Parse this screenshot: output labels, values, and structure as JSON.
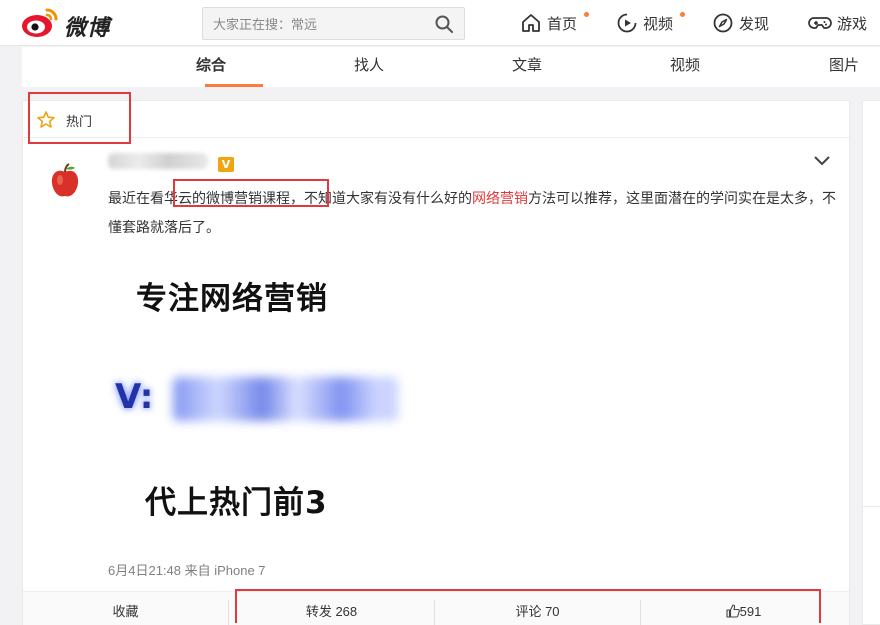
{
  "header": {
    "brand": "微博",
    "search_placeholder": "大家正在搜：常远",
    "nav": [
      {
        "label": "首页",
        "icon": "home-icon"
      },
      {
        "label": "视频",
        "icon": "video-icon"
      },
      {
        "label": "发现",
        "icon": "compass-icon"
      },
      {
        "label": "游戏",
        "icon": "gamepad-icon"
      }
    ]
  },
  "tabs": [
    "综合",
    "找人",
    "文章",
    "视频",
    "图片"
  ],
  "feed": {
    "section_label": "热门",
    "post": {
      "vip_badge": "V",
      "text_parts": [
        "最近在看",
        "华云的微博营销课程",
        "，不知道大家有没有什么好的",
        "网络营销",
        "方法可以推荐，这里面潜在的学问实在是太多，不懂套路就落后了。"
      ],
      "image": {
        "line1": "专注网络营销",
        "line2_prefix": "V:",
        "line3": "代上热门前3"
      },
      "meta": "6月4日21:48 来自 iPhone 7",
      "actions": {
        "favorite": "收藏",
        "repost": "转发 268",
        "comment": "评论 70",
        "like": "591"
      }
    }
  },
  "colors": {
    "accent": "#fa7d3c",
    "highlight": "#e0393e",
    "vip": "#f0a410"
  }
}
